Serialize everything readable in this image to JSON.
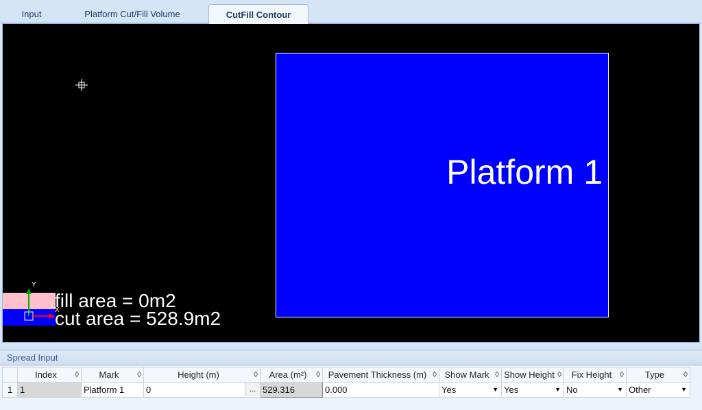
{
  "tabs": [
    {
      "label": "Input"
    },
    {
      "label": "Platform Cut/Fill Volume"
    },
    {
      "label": "CutFill Contour"
    }
  ],
  "active_tab": "CutFill Contour",
  "viewport": {
    "platform_label": "Platform 1",
    "fill_area_text": "fill area = 0m2",
    "cut_area_text": "cut area = 528.9m2",
    "axis_y_label": "Y",
    "axis_x_label": "X",
    "colors": {
      "background": "#000000",
      "platform_fill": "#0000ff",
      "fill_swatch": "#ffc0cb",
      "cut_swatch": "#0000ff"
    }
  },
  "spread_input": {
    "title": "Spread Input",
    "columns": [
      "",
      "Index",
      "Mark",
      "Height (m)",
      "Area (m²)",
      "Pavement Thickness (m)",
      "Show Mark",
      "Show Height",
      "Fix Height",
      "Type"
    ],
    "rows": [
      {
        "row_number": "1",
        "index": "1",
        "mark": "Platform 1",
        "height": "0",
        "height_button": "...",
        "area": "529.316",
        "pavement_thickness": "0.000",
        "show_mark": "Yes",
        "show_height": "Yes",
        "fix_height": "No",
        "type": "Other"
      }
    ]
  },
  "icons": {
    "sort": "sort-diamond-icon",
    "dropdown": "dropdown-arrow-icon",
    "crosshair": "crosshair-cursor-icon"
  }
}
